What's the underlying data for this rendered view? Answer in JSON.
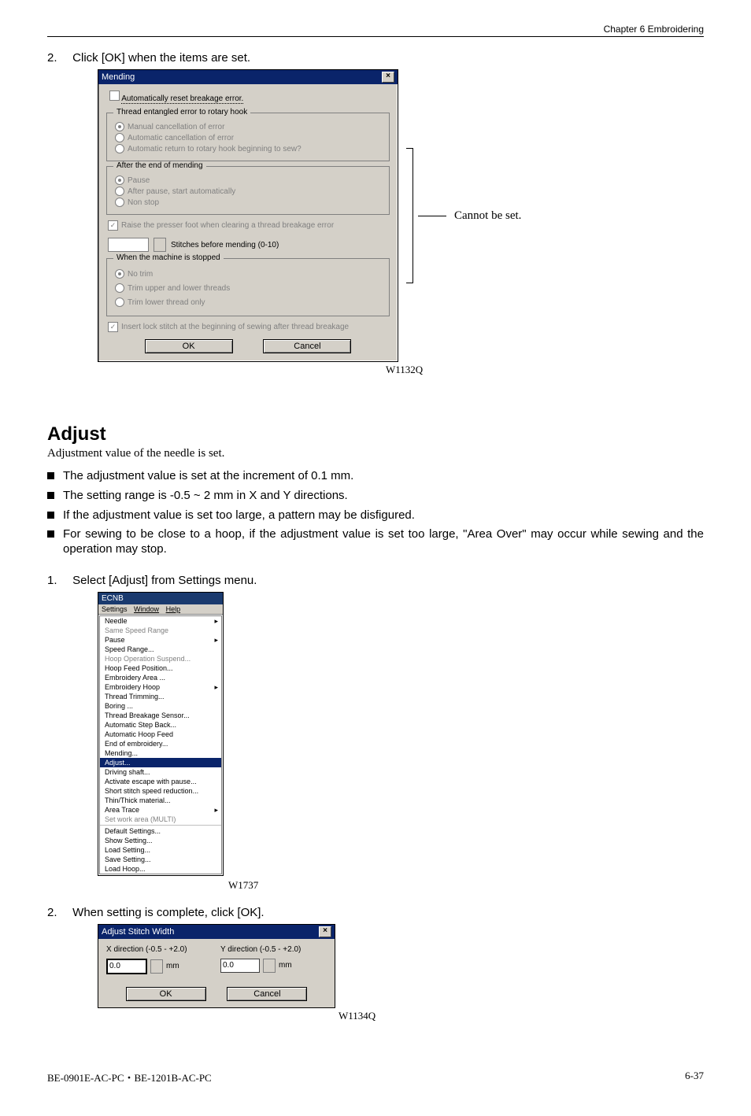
{
  "header": {
    "chapter": "Chapter 6   Embroidering"
  },
  "step2a": {
    "num": "2.",
    "text": "Click [OK] when the items are set."
  },
  "mending": {
    "title": "Mending",
    "auto_reset": "Automatically reset breakage error.",
    "grp1_legend": "Thread entangled error to rotary hook",
    "grp1_o1": "Manual cancellation of error",
    "grp1_o2": "Automatic cancellation of error",
    "grp1_o3": "Automatic return to rotary hook beginning to sew?",
    "grp2_legend": "After the end of mending",
    "grp2_o1": "Pause",
    "grp2_o2": "After pause, start automatically",
    "grp2_o3": "Non stop",
    "chk_raise": "Raise the presser foot when clearing a thread breakage error",
    "stitches_before": "Stitches before mending  (0-10)",
    "grp3_legend": "When the machine is stopped",
    "grp3_o1": "No trim",
    "grp3_o2": "Trim upper and lower threads",
    "grp3_o3": "Trim lower thread only",
    "chk_lock": "Insert lock stitch at the beginning of sewing after thread breakage",
    "ok": "OK",
    "cancel": "Cancel",
    "cannot": "Cannot be set.",
    "fig": "W1132Q"
  },
  "adjust": {
    "heading": "Adjust",
    "intro": "Adjustment value of the needle is set.",
    "b1": "The adjustment value is set at the increment of 0.1 mm.",
    "b2": "The setting range is -0.5 ~ 2 mm in X and Y directions.",
    "b3": "If the adjustment value is set too large, a pattern may be disfigured.",
    "b4": "For sewing to be close to a hoop, if the adjustment value is set too large, \"Area Over\" may occur while sewing and the operation may stop."
  },
  "step1b": {
    "num": "1.",
    "text": "Select [Adjust] from Settings menu."
  },
  "menu": {
    "window_title": "ECNB",
    "bar_settings": "Settings",
    "bar_window": "Window",
    "bar_help": "Help",
    "items": {
      "needle": "Needle",
      "same_speed": "Same Speed Range",
      "pause": "Pause",
      "speed_range": "Speed Range...",
      "hoop_op": "Hoop Operation Suspend...",
      "hoop_feed": "Hoop Feed Position...",
      "emb_area": "Embroidery Area ...",
      "emb_hoop": "Embroidery Hoop",
      "thread_trim": "Thread Trimming...",
      "boring": "Boring ...",
      "thread_break": "Thread Breakage Sensor...",
      "auto_step": "Automatic Step Back...",
      "auto_hoop": "Automatic Hoop Feed",
      "end_emb": "End of embroidery...",
      "mending": "Mending...",
      "adjust": "Adjust...",
      "driving": "Driving shaft...",
      "activate": "Activate escape with pause...",
      "short_stitch": "Short stitch speed reduction...",
      "thin_thick": "Thin/Thick material...",
      "area_trace": "Area Trace",
      "set_work": "Set work area (MULTI)",
      "default": "Default Settings...",
      "show": "Show Setting...",
      "load_set": "Load Setting...",
      "save_set": "Save Setting...",
      "load_hoop": "Load Hoop..."
    },
    "fig": "W1737"
  },
  "step2b": {
    "num": "2.",
    "text": "When setting is complete, click [OK]."
  },
  "adjdlg": {
    "title": "Adjust Stitch Width",
    "xlabel": "X direction (-0.5 - +2.0)",
    "ylabel": "Y direction (-0.5 - +2.0)",
    "xval": "0.0",
    "yval": "0.0",
    "mm": "mm",
    "ok": "OK",
    "cancel": "Cancel",
    "fig": "W1134Q"
  },
  "footer": {
    "left": "BE-0901E-AC-PC・BE-1201B-AC-PC",
    "right": "6-37"
  }
}
